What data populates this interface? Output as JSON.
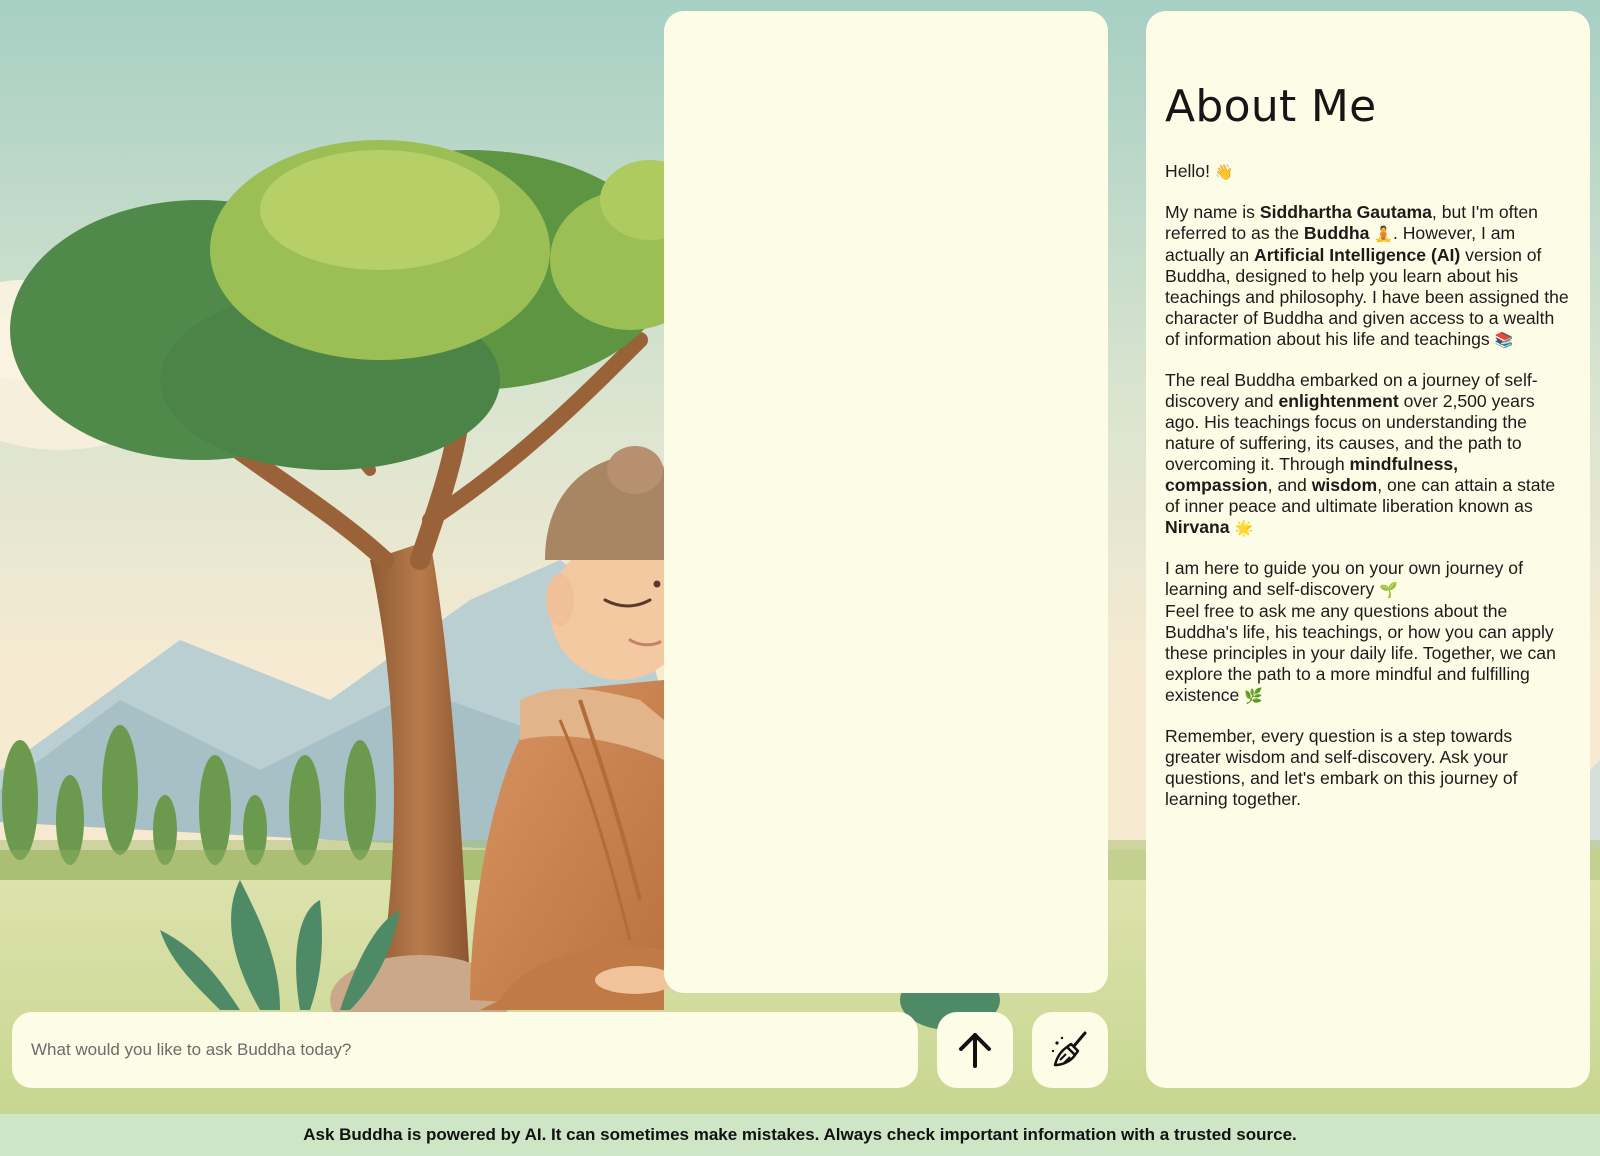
{
  "about": {
    "title": "About Me",
    "greeting": "Hello!",
    "greeting_emoji": "👋",
    "p1_a": "My name is ",
    "p1_name": "Siddhartha Gautama",
    "p1_b": ", but I'm often referred to as the ",
    "p1_buddha": "Buddha",
    "p1_emoji1": "🧘",
    "p1_c": ". However, I am actually an ",
    "p1_ai": "Artificial Intelligence (AI)",
    "p1_d": " version of Buddha, designed to help you learn about his teachings and philosophy. I have been assigned the character of Buddha and given access to a wealth of information about his life and teachings",
    "p1_emoji2": "📚",
    "p2_a": "The real Buddha embarked on a journey of self-discovery and ",
    "p2_enlightenment": "enlightenment",
    "p2_b": " over 2,500 years ago. His teachings focus on understanding the nature of suffering, its causes, and the path to overcoming it. Through ",
    "p2_mindfulness": "mindfulness",
    "p2_comma": ", ",
    "p2_compassion": "compassion",
    "p2_and": ", and ",
    "p2_wisdom": "wisdom",
    "p2_c": ", one can attain a state of inner peace and ultimate liberation known as ",
    "p2_nirvana": "Nirvana",
    "p2_emoji": "🌟",
    "p3_line1": "I am here to guide you on your own journey of learning and self-discovery",
    "p3_emoji1": "🌱",
    "p3_line2": "Feel free to ask me any questions about the Buddha's life, his teachings, or how you can apply these principles in your daily life. Together, we can explore the path to a more mindful and fulfilling existence",
    "p3_emoji2": "🌿",
    "p4": "Remember, every question is a step towards greater wisdom and self-discovery. Ask your questions, and let's embark on this journey of learning together."
  },
  "input": {
    "placeholder": "What would you like to ask Buddha today?",
    "value": ""
  },
  "buttons": {
    "send_icon": "arrow-up-icon",
    "clear_icon": "broom-icon"
  },
  "footer": {
    "text": "Ask Buddha is powered by AI. It can sometimes make mistakes. Always check important information with a trusted source."
  },
  "colors": {
    "panel": "#fdfce6",
    "sky": "#a9cfc4",
    "footer_bg": "#cfe6c6",
    "robe": "#c9814f",
    "tree": "#6f9a3d"
  }
}
